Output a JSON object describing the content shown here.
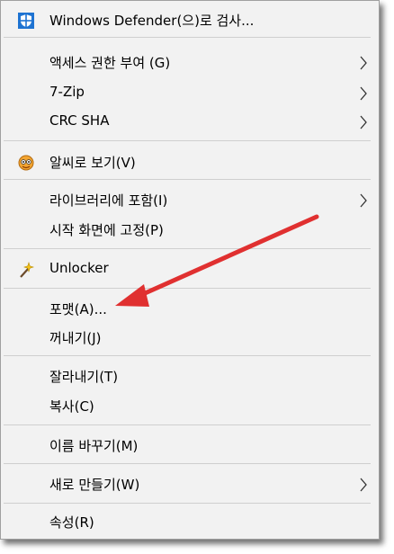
{
  "menu": {
    "items": [
      {
        "label": "Windows Defender(으)로 검사...",
        "icon": "windows-defender-shield-icon"
      },
      {
        "label": "액세스 권한 부여 (G)",
        "submenu": true
      },
      {
        "label": "7-Zip",
        "submenu": true
      },
      {
        "label": "CRC SHA",
        "submenu": true
      },
      {
        "label": "알씨로 보기(V)",
        "icon": "alsee-viewer-icon"
      },
      {
        "label": "라이브러리에 포함(I)",
        "submenu": true
      },
      {
        "label": "시작 화면에 고정(P)"
      },
      {
        "label": "Unlocker",
        "icon": "unlocker-wand-icon"
      },
      {
        "label": "포맷(A)..."
      },
      {
        "label": "꺼내기(J)"
      },
      {
        "label": "잘라내기(T)"
      },
      {
        "label": "복사(C)"
      },
      {
        "label": "이름 바꾸기(M)"
      },
      {
        "label": "새로 만들기(W)",
        "submenu": true
      },
      {
        "label": "속성(R)"
      }
    ]
  },
  "colors": {
    "menu_background": "#f2f2f2",
    "separator": "#cfcfcf",
    "annotation_arrow": "#e03030",
    "defender_blue": "#1e73d2"
  },
  "annotation": {
    "type": "arrow",
    "points_to": "포맷(A)..."
  }
}
